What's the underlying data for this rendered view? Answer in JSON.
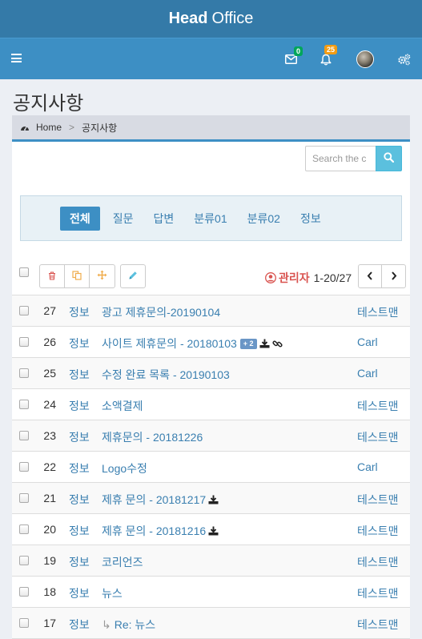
{
  "header": {
    "brand_bold": "Head",
    "brand_rest": "Office"
  },
  "navbar": {
    "mail_count": "0",
    "notif_count": "25"
  },
  "page": {
    "title": "공지사항"
  },
  "breadcrumb": {
    "home": "Home",
    "separator": ">",
    "current": "공지사항"
  },
  "search": {
    "placeholder": "Search the c"
  },
  "categories": [
    "전체",
    "질문",
    "답변",
    "분류01",
    "분류02",
    "정보"
  ],
  "toolbar": {
    "user": "관리자",
    "page_range": "1-20/27"
  },
  "colors": {
    "topbar": "#347aa8",
    "navbar": "#3d8fc4",
    "link": "#3a7fb0",
    "admin": "#d9534f",
    "mail_badge": "#00a65a",
    "notif_badge": "#f39c12"
  },
  "posts": [
    {
      "num": "27",
      "cat": "정보",
      "title": "광고 제휴문의-20190104",
      "author": "테스트맨",
      "count": "",
      "download": false,
      "link": false,
      "reply": false
    },
    {
      "num": "26",
      "cat": "정보",
      "title": "사이트 제휴문의 - 20180103",
      "author": "Carl",
      "count": "+ 2",
      "download": true,
      "link": true,
      "reply": false
    },
    {
      "num": "25",
      "cat": "정보",
      "title": "수정 완료 목록 - 20190103",
      "author": "Carl",
      "count": "",
      "download": false,
      "link": false,
      "reply": false
    },
    {
      "num": "24",
      "cat": "정보",
      "title": "소액결제",
      "author": "테스트맨",
      "count": "",
      "download": false,
      "link": false,
      "reply": false
    },
    {
      "num": "23",
      "cat": "정보",
      "title": "제휴문의 - 20181226",
      "author": "테스트맨",
      "count": "",
      "download": false,
      "link": false,
      "reply": false
    },
    {
      "num": "22",
      "cat": "정보",
      "title": "Logo수정",
      "author": "Carl",
      "count": "",
      "download": false,
      "link": false,
      "reply": false
    },
    {
      "num": "21",
      "cat": "정보",
      "title": "제휴 문의 - 20181217",
      "author": "테스트맨",
      "count": "",
      "download": true,
      "link": false,
      "reply": false
    },
    {
      "num": "20",
      "cat": "정보",
      "title": "제휴 문의 - 20181216",
      "author": "테스트맨",
      "count": "",
      "download": true,
      "link": false,
      "reply": false
    },
    {
      "num": "19",
      "cat": "정보",
      "title": "코리언즈",
      "author": "테스트맨",
      "count": "",
      "download": false,
      "link": false,
      "reply": false
    },
    {
      "num": "18",
      "cat": "정보",
      "title": "뉴스",
      "author": "테스트맨",
      "count": "",
      "download": false,
      "link": false,
      "reply": false
    },
    {
      "num": "17",
      "cat": "정보",
      "title": "Re: 뉴스",
      "author": "테스트맨",
      "count": "",
      "download": false,
      "link": false,
      "reply": true
    },
    {
      "num": "",
      "cat": "",
      "title": "",
      "author": "",
      "count": "",
      "download": false,
      "link": false,
      "reply": false
    }
  ]
}
